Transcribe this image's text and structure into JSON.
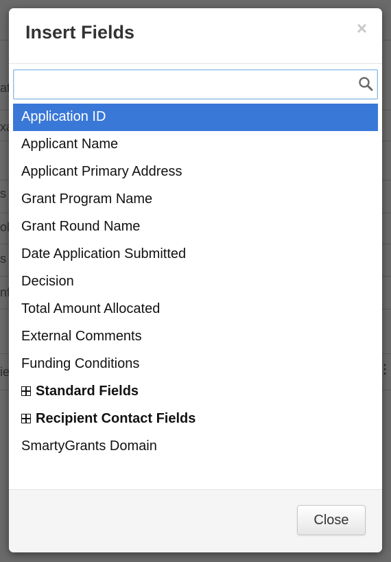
{
  "dialog": {
    "title": "Insert Fields",
    "close_glyph": "×",
    "close_label": "Close"
  },
  "search": {
    "value": "",
    "placeholder": "",
    "icon": "search-icon"
  },
  "fields": [
    {
      "label": "Application ID",
      "selected": true
    },
    {
      "label": "Applicant Name"
    },
    {
      "label": "Applicant Primary Address"
    },
    {
      "label": "Grant Program Name"
    },
    {
      "label": "Grant Round Name"
    },
    {
      "label": "Date Application Submitted"
    },
    {
      "label": "Decision"
    },
    {
      "label": "Total Amount Allocated"
    },
    {
      "label": "External Comments"
    },
    {
      "label": "Funding Conditions"
    },
    {
      "label": "Standard Fields",
      "group": true,
      "icon": "grid-expand-icon"
    },
    {
      "label": "Recipient Contact Fields",
      "group": true,
      "icon": "grid-expand-icon"
    },
    {
      "label": "SmartyGrants Domain"
    }
  ],
  "background_fragments": [
    "at",
    "xa",
    "s v",
    "oll",
    "s v",
    "nf",
    "ie"
  ],
  "colors": {
    "selected_bg": "#3a78d8",
    "backdrop": "#5f5f5f"
  }
}
